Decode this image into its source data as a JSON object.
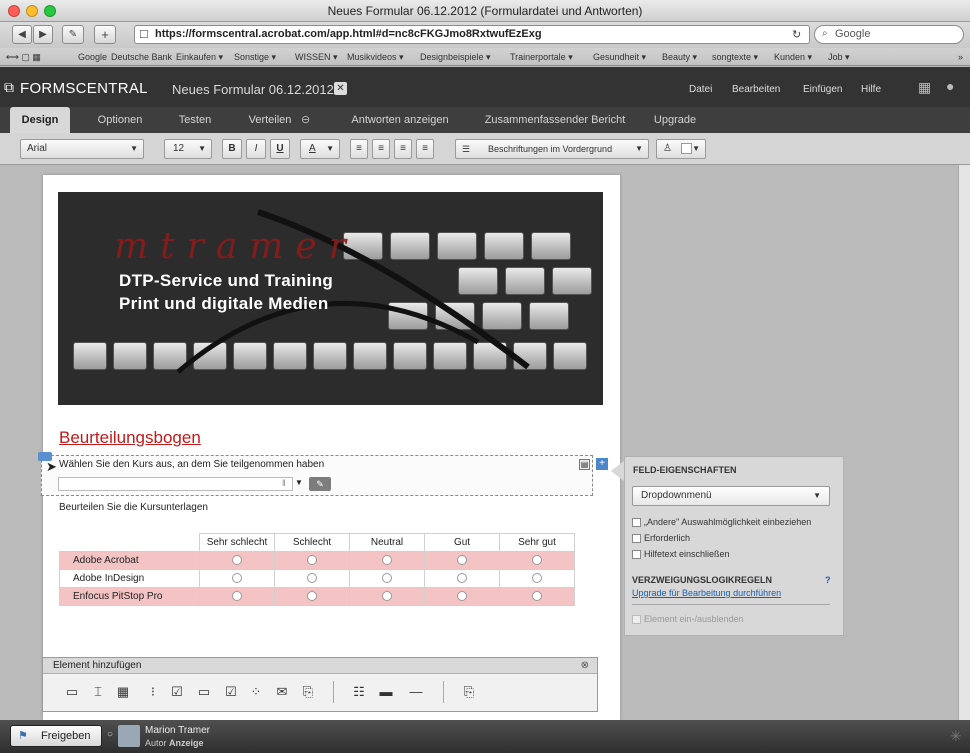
{
  "browser": {
    "title": "Neues Formular 06.12.2012 (Formulardatei und Antworten)",
    "url": "https://formscentral.acrobat.com/app.html#d=nc8cFKGJmo8RxtwufEzExg",
    "search_placeholder": "Google",
    "bookmarks": [
      "Google",
      "Deutsche Bank",
      "Einkaufen ▾",
      "Sonstige ▾",
      "WISSEN ▾",
      "Musikvideos ▾",
      "Designbeispiele ▾",
      "Trainerportale ▾",
      "Gesundheit ▾",
      "Beauty ▾",
      "songtexte ▾",
      "Kunden ▾",
      "Job ▾"
    ]
  },
  "app": {
    "logo": "FORMSCENTRAL",
    "form_name": "Neues Formular 06.12.2012",
    "menu": [
      "Datei",
      "Bearbeiten",
      "Einfügen",
      "Hilfe"
    ]
  },
  "tabs": [
    "Design",
    "Optionen",
    "Testen",
    "Verteilen",
    "Antworten anzeigen",
    "Zusammenfassender Bericht",
    "Upgrade"
  ],
  "toolbar": {
    "font": "Arial",
    "size": "12",
    "bold": "B",
    "italic": "I",
    "underline": "U",
    "color": "A",
    "label_position": "Beschriftungen im Vordergrund"
  },
  "banner": {
    "brand": "mtramer",
    "line1": "DTP-Service und Training",
    "line2": "Print und digitale Medien"
  },
  "form": {
    "title": "Beurteilungsbogen",
    "question1": "Wählen Sie den Kurs aus, an dem Sie teilgenommen haben",
    "question2": "Beurteilen Sie die Kursunterlagen",
    "columns": [
      "Sehr schlecht",
      "Schlecht",
      "Neutral",
      "Gut",
      "Sehr gut"
    ],
    "rows": [
      "Adobe Acrobat",
      "Adobe InDesign",
      "Enfocus PitStop Pro"
    ]
  },
  "element_bar": {
    "title": "Element hinzufügen"
  },
  "properties": {
    "title": "FELD-EIGENSCHAFTEN",
    "type": "Dropdownmenü",
    "opt_other": "„Andere\" Auswahlmöglichkeit einbeziehen",
    "opt_required": "Erforderlich",
    "opt_help": "Hilfetext einschließen",
    "logic_title": "VERZWEIGUNGSLOGIKREGELN",
    "logic_help": "?",
    "logic_link": "Upgrade für Bearbeitung durchführen",
    "toggle": "Element ein-/ausblenden"
  },
  "status": {
    "share": "Freigeben",
    "user": "Marion Tramer",
    "role_prefix": "Autor",
    "role": "Anzeige"
  },
  "colors": {
    "accent_red": "#c41a1a",
    "row_pink": "#f4c4c4",
    "header_dark": "#333333",
    "link_blue": "#1a5fb4"
  }
}
